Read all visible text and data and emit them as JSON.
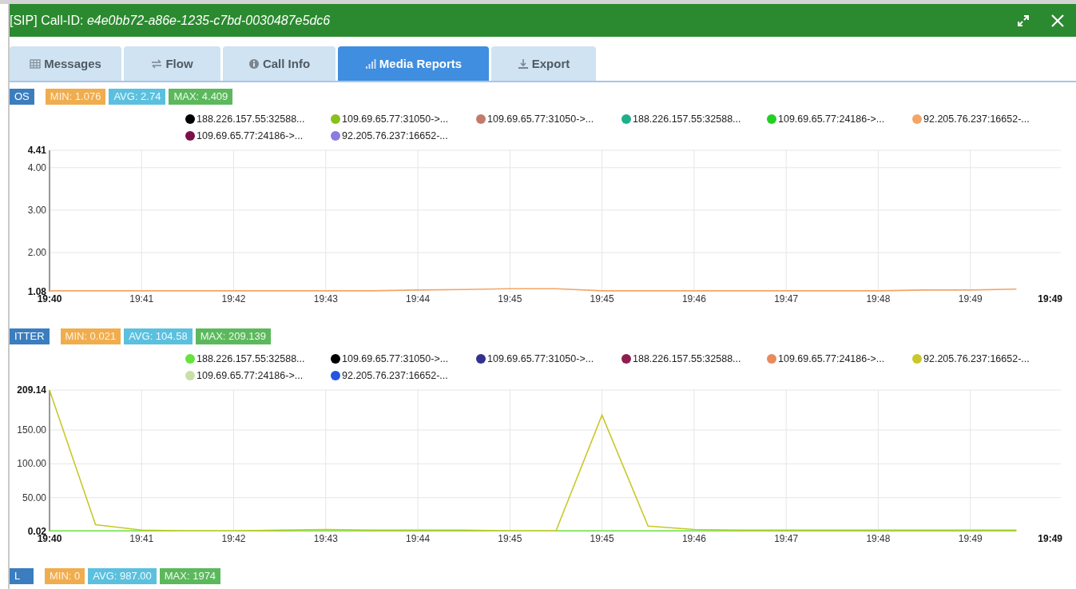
{
  "window": {
    "title": "[SIP] Call-ID: *e4e0bb72-a86e-1235-c7bd-0030487e5dc6*"
  },
  "tabs": [
    {
      "label": "Messages",
      "selected": false
    },
    {
      "label": "Flow",
      "selected": false
    },
    {
      "label": "Call Info",
      "selected": false
    },
    {
      "label": "Media Reports",
      "selected": true
    },
    {
      "label": "Export",
      "selected": false
    }
  ],
  "panels": [
    {
      "label": "OS",
      "stats": [
        {
          "kind": "min",
          "text": "MIN: 1.076"
        },
        {
          "kind": "avg",
          "text": "AVG: 2.74"
        },
        {
          "kind": "max",
          "text": "MAX: 4.409"
        }
      ],
      "chart_data": {
        "type": "line",
        "grid": true,
        "ylim": [
          1.08,
          4.41
        ],
        "categories": [
          "19:40",
          null,
          "19:41",
          null,
          "19:42",
          null,
          "19:43",
          null,
          "19:44",
          null,
          "19:45",
          null,
          "19:45",
          null,
          "19:46",
          null,
          "19:47",
          null,
          "19:48",
          null,
          "19:49",
          null,
          "19:49"
        ],
        "yticks": [
          {
            "value": 1.08,
            "label": "1.08"
          },
          {
            "value": 2,
            "label": "2.00"
          },
          {
            "value": 3,
            "label": "3.00"
          },
          {
            "value": 4,
            "label": "4.00"
          },
          {
            "value": 4.41,
            "label": "4.41"
          }
        ],
        "series": [
          {
            "name": "188.226.157.55:32588...",
            "color": "#000000",
            "values": [
              null,
              null,
              null,
              null,
              null,
              null,
              null,
              null,
              null,
              null,
              null,
              null,
              null,
              null,
              null,
              null,
              null,
              null,
              null,
              null,
              null,
              null,
              null
            ]
          },
          {
            "name": "109.69.65.77:31050->...",
            "color": "#8bbf1e",
            "values": [
              null,
              null,
              null,
              null,
              null,
              null,
              null,
              null,
              null,
              null,
              null,
              null,
              null,
              null,
              null,
              null,
              null,
              null,
              null,
              null,
              null,
              null,
              null
            ]
          },
          {
            "name": "109.69.65.77:31050->...",
            "color": "#c27b6b",
            "values": [
              null,
              null,
              null,
              null,
              null,
              null,
              null,
              null,
              null,
              null,
              null,
              null,
              null,
              null,
              null,
              null,
              null,
              null,
              null,
              null,
              null,
              null,
              null
            ]
          },
          {
            "name": "188.226.157.55:32588...",
            "color": "#1fae8a",
            "values": [
              null,
              null,
              null,
              null,
              null,
              null,
              null,
              null,
              null,
              null,
              null,
              null,
              null,
              null,
              null,
              null,
              null,
              null,
              null,
              null,
              null,
              null,
              null
            ]
          },
          {
            "name": "109.69.65.77:24186->...",
            "color": "#22d022",
            "values": [
              null,
              null,
              null,
              null,
              null,
              null,
              null,
              null,
              null,
              null,
              null,
              null,
              null,
              null,
              null,
              null,
              null,
              null,
              null,
              null,
              null,
              null,
              null
            ]
          },
          {
            "name": "92.205.76.237:16652-...",
            "color": "#f2a567",
            "values": [
              1.1,
              1.1,
              1.1,
              1.1,
              1.1,
              1.1,
              1.1,
              1.1,
              1.12,
              1.13,
              1.15,
              1.15,
              1.1,
              1.1,
              1.1,
              1.1,
              1.1,
              1.1,
              1.1,
              1.12,
              1.12,
              1.14,
              null
            ]
          },
          {
            "name": "109.69.65.77:24186->...",
            "color": "#7a0f4a",
            "values": [
              null,
              null,
              null,
              null,
              null,
              null,
              null,
              null,
              null,
              null,
              null,
              null,
              null,
              null,
              null,
              null,
              null,
              null,
              null,
              null,
              null,
              null,
              null
            ]
          },
          {
            "name": "92.205.76.237:16652-...",
            "color": "#8a7de0",
            "values": [
              null,
              null,
              null,
              null,
              null,
              null,
              null,
              null,
              null,
              null,
              null,
              null,
              null,
              null,
              null,
              null,
              null,
              null,
              null,
              null,
              null,
              null,
              null
            ]
          }
        ]
      }
    },
    {
      "label": "ITTER",
      "stats": [
        {
          "kind": "min",
          "text": "MIN: 0.021"
        },
        {
          "kind": "avg",
          "text": "AVG: 104.58"
        },
        {
          "kind": "max",
          "text": "MAX: 209.139"
        }
      ],
      "chart_data": {
        "type": "line",
        "grid": true,
        "ylim": [
          0.02,
          209.14
        ],
        "categories": [
          "19:40",
          null,
          "19:41",
          null,
          "19:42",
          null,
          "19:43",
          null,
          "19:44",
          null,
          "19:45",
          null,
          "19:45",
          null,
          "19:46",
          null,
          "19:47",
          null,
          "19:48",
          null,
          "19:49",
          null,
          "19:49"
        ],
        "yticks": [
          {
            "value": 0.02,
            "label": "0.02"
          },
          {
            "value": 50,
            "label": "50.00"
          },
          {
            "value": 100,
            "label": "100.00"
          },
          {
            "value": 150,
            "label": "150.00"
          },
          {
            "value": 209.14,
            "label": "209.14"
          }
        ],
        "series": [
          {
            "name": "188.226.157.55:32588...",
            "color": "#66e23c",
            "values": [
              1,
              1,
              1,
              1,
              1,
              1,
              1,
              1,
              1,
              1,
              1,
              1,
              1,
              1,
              1,
              1,
              1,
              1,
              1,
              1,
              1,
              1,
              null
            ]
          },
          {
            "name": "109.69.65.77:31050->...",
            "color": "#000000",
            "values": [
              null,
              null,
              null,
              null,
              null,
              null,
              null,
              null,
              null,
              null,
              null,
              null,
              null,
              null,
              null,
              null,
              null,
              null,
              null,
              null,
              null,
              null,
              null
            ]
          },
          {
            "name": "109.69.65.77:31050->...",
            "color": "#33318f",
            "values": [
              null,
              null,
              null,
              null,
              null,
              null,
              null,
              null,
              null,
              null,
              null,
              null,
              null,
              null,
              null,
              null,
              null,
              null,
              null,
              null,
              null,
              null,
              null
            ]
          },
          {
            "name": "188.226.157.55:32588...",
            "color": "#8e1e4e",
            "values": [
              null,
              null,
              null,
              null,
              null,
              null,
              null,
              null,
              null,
              null,
              null,
              null,
              null,
              null,
              null,
              null,
              null,
              null,
              null,
              null,
              null,
              null,
              null
            ]
          },
          {
            "name": "109.69.65.77:24186->...",
            "color": "#e88a5c",
            "values": [
              null,
              null,
              null,
              null,
              null,
              null,
              null,
              null,
              null,
              null,
              null,
              null,
              null,
              null,
              null,
              null,
              null,
              null,
              null,
              null,
              null,
              null,
              null
            ]
          },
          {
            "name": "92.205.76.237:16652-...",
            "color": "#c8c82a",
            "values": [
              209,
              10,
              2,
              1,
              1,
              2,
              3,
              2,
              2,
              2,
              1,
              1,
              172,
              8,
              3,
              2,
              2,
              2,
              2,
              2,
              2,
              2,
              null
            ]
          },
          {
            "name": "109.69.65.77:24186->...",
            "color": "#c8e0a8",
            "values": [
              null,
              null,
              null,
              null,
              null,
              null,
              null,
              null,
              null,
              null,
              null,
              null,
              null,
              null,
              null,
              null,
              null,
              null,
              null,
              null,
              null,
              null,
              null
            ]
          },
          {
            "name": "92.205.76.237:16652-...",
            "color": "#2456e0",
            "values": [
              null,
              null,
              null,
              null,
              null,
              null,
              null,
              null,
              null,
              null,
              null,
              null,
              null,
              null,
              null,
              null,
              null,
              null,
              null,
              null,
              null,
              null,
              null
            ]
          }
        ]
      }
    },
    {
      "label": "L",
      "stats": [
        {
          "kind": "min",
          "text": "MIN: 0"
        },
        {
          "kind": "avg",
          "text": "AVG: 987.00"
        },
        {
          "kind": "max",
          "text": "MAX: 1974"
        }
      ]
    }
  ]
}
